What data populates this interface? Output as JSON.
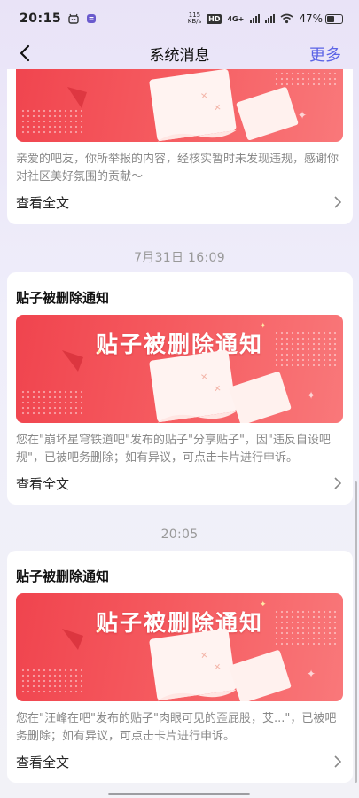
{
  "status_bar": {
    "time": "20:15",
    "net_speed_value": "115",
    "net_speed_unit": "KB/s",
    "hd_badge": "HD",
    "net_type": "4G+",
    "battery": "47%",
    "battery_level": 0.47
  },
  "nav": {
    "title": "系统消息",
    "more_label": "更多"
  },
  "banner_text": "贴子被删除通知",
  "messages": [
    {
      "desc": "亲爱的吧友，你所举报的内容，经核实暂时未发现违规，感谢你对社区美好氛围的贡献～",
      "read_more": "查看全文"
    },
    {
      "timestamp": "7月31日 16:09",
      "title": "贴子被删除通知",
      "desc": "您在\"崩坏星穹铁道吧\"发布的贴子\"分享贴子\"，因\"违反自设吧规\"，已被吧务删除；如有异议，可点击卡片进行申诉。",
      "read_more": "查看全文"
    },
    {
      "timestamp": "20:05",
      "title": "贴子被删除通知",
      "desc": "您在\"汪峰在吧\"发布的贴子\"肉眼可见的歪屁股，艾...\"，已被吧务删除；如有异议，可点击卡片进行申诉。",
      "read_more": "查看全文"
    }
  ],
  "colors": {
    "accent": "#5b63e6",
    "banner_red": "#f0444e"
  }
}
